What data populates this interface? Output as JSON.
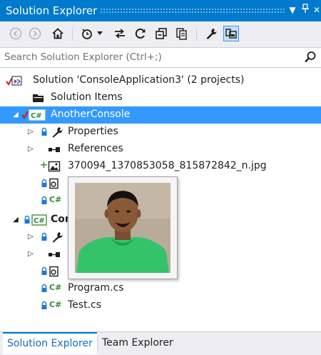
{
  "window": {
    "title": "Solution Explorer",
    "title_buttons": [
      "dropdown-icon",
      "pin-icon",
      "close-icon"
    ]
  },
  "toolbar": {
    "buttons": [
      "back-icon",
      "forward-icon",
      "home-icon",
      "history-icon",
      "sync-icon",
      "refresh-icon",
      "collapse-all-icon",
      "show-all-files-icon",
      "properties-icon",
      "preview-icon"
    ]
  },
  "search": {
    "placeholder": "Search Solution Explorer (Ctrl+;)"
  },
  "tree": {
    "solution": "Solution 'ConsoleApplication3' (2 projects)",
    "solution_items": "Solution Items",
    "project1": "AnotherConsole",
    "properties": "Properties",
    "references": "References",
    "image_file": "370094_1370853058_815872842_n.jpg",
    "project2_partial": "Con",
    "program_cs": "Program.cs",
    "test_cs": "Test.cs"
  },
  "bottom_tabs": {
    "active": "Solution Explorer",
    "inactive": "Team Explorer"
  },
  "colors": {
    "accent": "#007acc",
    "selection": "#3399ff",
    "chrome": "#eeeef2",
    "csharp_green": "#388a34",
    "lock_blue": "#1e7ad6"
  }
}
